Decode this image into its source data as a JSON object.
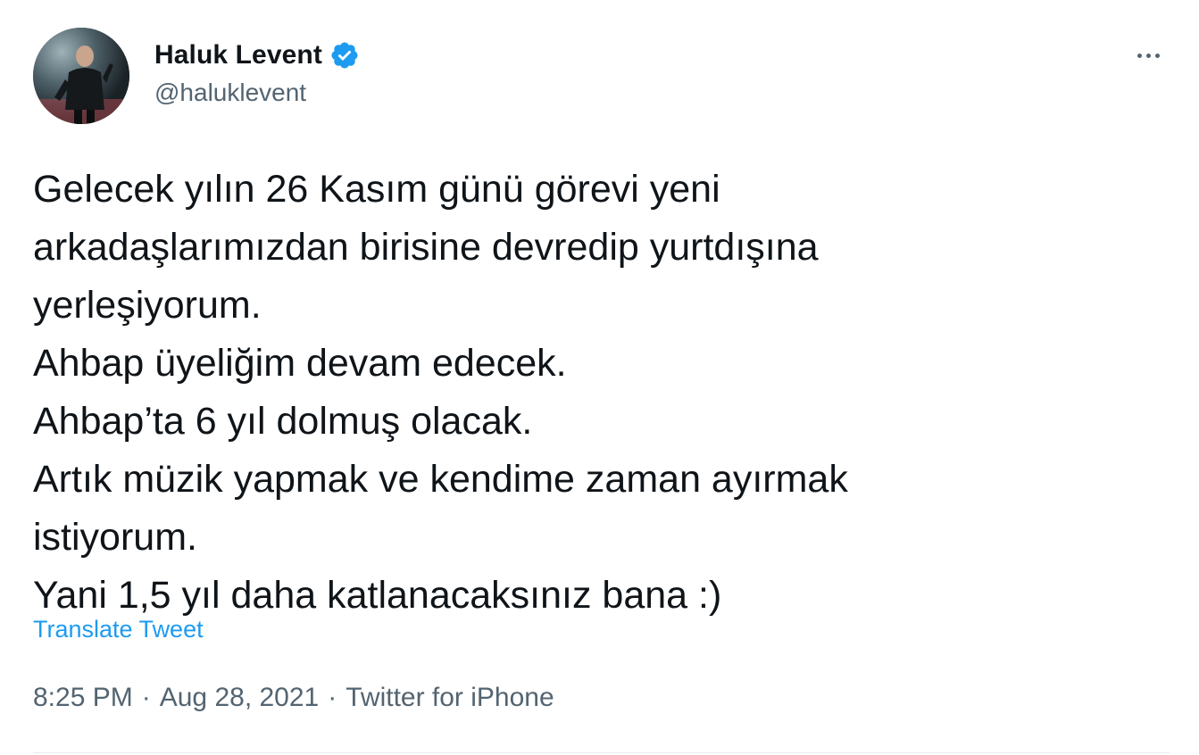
{
  "author": {
    "display_name": "Haluk Levent",
    "handle": "@haluklevent",
    "verified_icon": "verified-badge-icon",
    "avatar_icon": "profile-photo"
  },
  "menu": {
    "more_icon": "more-options-icon"
  },
  "tweet": {
    "lines": [
      "Gelecek yılın 26 Kasım günü görevi yeni",
      "arkadaşlarımızdan birisine devredip yurtdışına",
      "yerleşiyorum.",
      "Ahbap üyeliğim devam edecek.",
      "Ahbap’ta 6 yıl dolmuş olacak.",
      "Artık müzik yapmak ve kendime zaman ayırmak",
      "istiyorum.",
      "Yani 1,5 yıl daha katlanacaksınız bana :)"
    ],
    "translate_label": "Translate Tweet"
  },
  "meta": {
    "time": "8:25 PM",
    "separator": "·",
    "date": "Aug 28, 2021",
    "source": "Twitter for iPhone"
  },
  "colors": {
    "text": "#0f1419",
    "secondary": "#536471",
    "link": "#1d9bf0",
    "verified": "#1d9bf0",
    "divider": "#e6ecf0"
  }
}
